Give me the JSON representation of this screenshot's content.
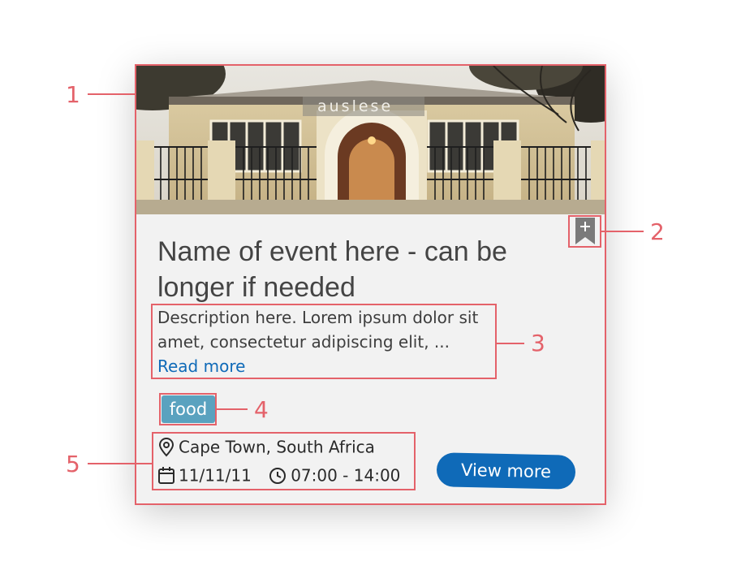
{
  "event": {
    "title": "Name of event here - can be longer if needed",
    "description": "Description here. Lorem ipsum dolor sit amet, consectetur adipiscing elit, ...",
    "read_more": "Read more",
    "tag": "food",
    "location": "Cape Town, South Africa",
    "date": "11/11/11",
    "time": "07:00 - 14:00",
    "view_more": "View more",
    "photo_sign": "auslese",
    "bookmark_icon": "bookmark-plus-icon"
  },
  "callouts": {
    "c1": "1",
    "c2": "2",
    "c3": "3",
    "c4": "4",
    "c5": "5"
  },
  "colors": {
    "accent": "#0f6ab8",
    "tag": "#5aa2bf",
    "annotation": "#e4626a",
    "card": "#f2f2f2",
    "bookmark": "#7a7a7a"
  }
}
